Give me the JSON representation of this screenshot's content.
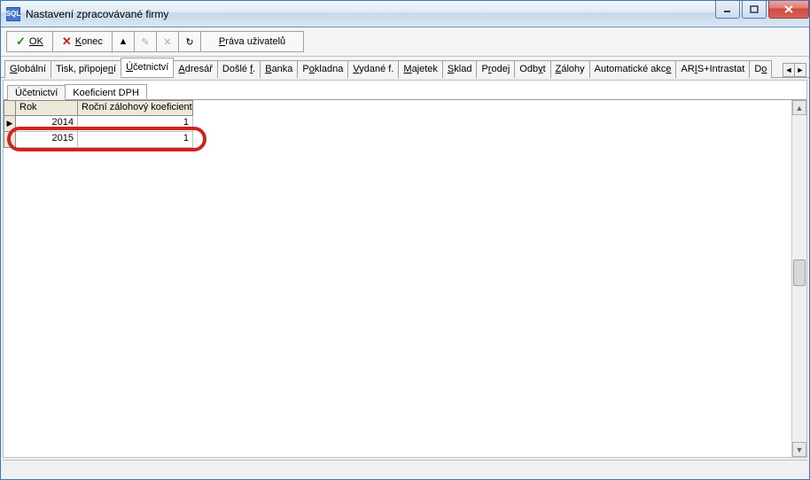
{
  "window": {
    "app_icon_text": "SQL",
    "title": "Nastavení zpracovávané firmy"
  },
  "toolbar": {
    "ok_label": "OK",
    "konec_label": "Konec",
    "prava_label": "Práva uživatelů"
  },
  "main_tabs": {
    "items": [
      {
        "label_pre": "",
        "label_u": "G",
        "label_post": "lobální"
      },
      {
        "label_pre": "Tisk, připoje",
        "label_u": "n",
        "label_post": "í"
      },
      {
        "label_pre": "",
        "label_u": "Ú",
        "label_post": "četnictví"
      },
      {
        "label_pre": "",
        "label_u": "A",
        "label_post": "dresář"
      },
      {
        "label_pre": "Došlé ",
        "label_u": "f",
        "label_post": "."
      },
      {
        "label_pre": "",
        "label_u": "B",
        "label_post": "anka"
      },
      {
        "label_pre": "P",
        "label_u": "o",
        "label_post": "kladna"
      },
      {
        "label_pre": "",
        "label_u": "V",
        "label_post": "ydané f."
      },
      {
        "label_pre": "",
        "label_u": "M",
        "label_post": "ajetek"
      },
      {
        "label_pre": "",
        "label_u": "S",
        "label_post": "klad"
      },
      {
        "label_pre": "P",
        "label_u": "r",
        "label_post": "odej"
      },
      {
        "label_pre": "Odb",
        "label_u": "y",
        "label_post": "t"
      },
      {
        "label_pre": "",
        "label_u": "Z",
        "label_post": "álohy"
      },
      {
        "label_pre": "Automatické akc",
        "label_u": "e",
        "label_post": ""
      },
      {
        "label_pre": "AR",
        "label_u": "I",
        "label_post": "S+Intrastat"
      },
      {
        "label_pre": "D",
        "label_u": "o",
        "label_post": ""
      }
    ],
    "active_index": 2
  },
  "sub_tabs": {
    "items": [
      {
        "label": "Účetnictví"
      },
      {
        "label": "Koeficient DPH"
      }
    ],
    "active_index": 1
  },
  "grid": {
    "headers": {
      "col1": "Rok",
      "col2": "Roční zálohový koeficient"
    },
    "rows": [
      {
        "year": "2014",
        "coef": "1",
        "current": true
      },
      {
        "year": "2015",
        "coef": "1",
        "current": false
      }
    ]
  }
}
